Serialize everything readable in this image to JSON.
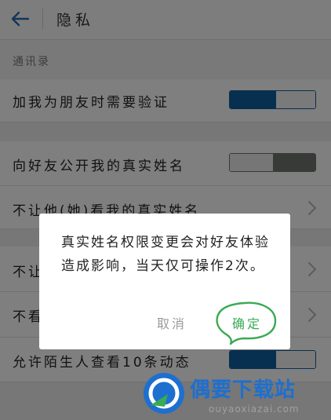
{
  "header": {
    "title": "隐私"
  },
  "section": {
    "label": "通讯录"
  },
  "rows": [
    {
      "label": "加我为朋友时需要验证",
      "control": "toggle",
      "state": "on"
    },
    {
      "label": "向好友公开我的真实姓名",
      "control": "toggle",
      "state": "off"
    },
    {
      "label": "不让他(她)看我的真实姓名",
      "control": "chevron"
    },
    {
      "label": "不让",
      "control": "chevron"
    },
    {
      "label": "不看",
      "control": "chevron"
    },
    {
      "label": "允许陌生人查看10条动态",
      "control": "toggle",
      "state": "on"
    }
  ],
  "dialog": {
    "message": "真实姓名权限变更会对好友体验造成影响，当天仅可操作2次。",
    "cancel_label": "取消",
    "ok_label": "确定"
  },
  "watermark": {
    "name": "偶要下载站",
    "url": "ouyaoxiazai.com"
  },
  "colors": {
    "accent": "#0f5f9e",
    "confirm": "#3aaa54",
    "watermark": "#1d6fd0"
  },
  "icons": {
    "back": "arrow-left-icon",
    "chevron": "chevron-right-icon",
    "annotation": "circle-annotation-icon",
    "logo": "watermark-logo-icon"
  }
}
